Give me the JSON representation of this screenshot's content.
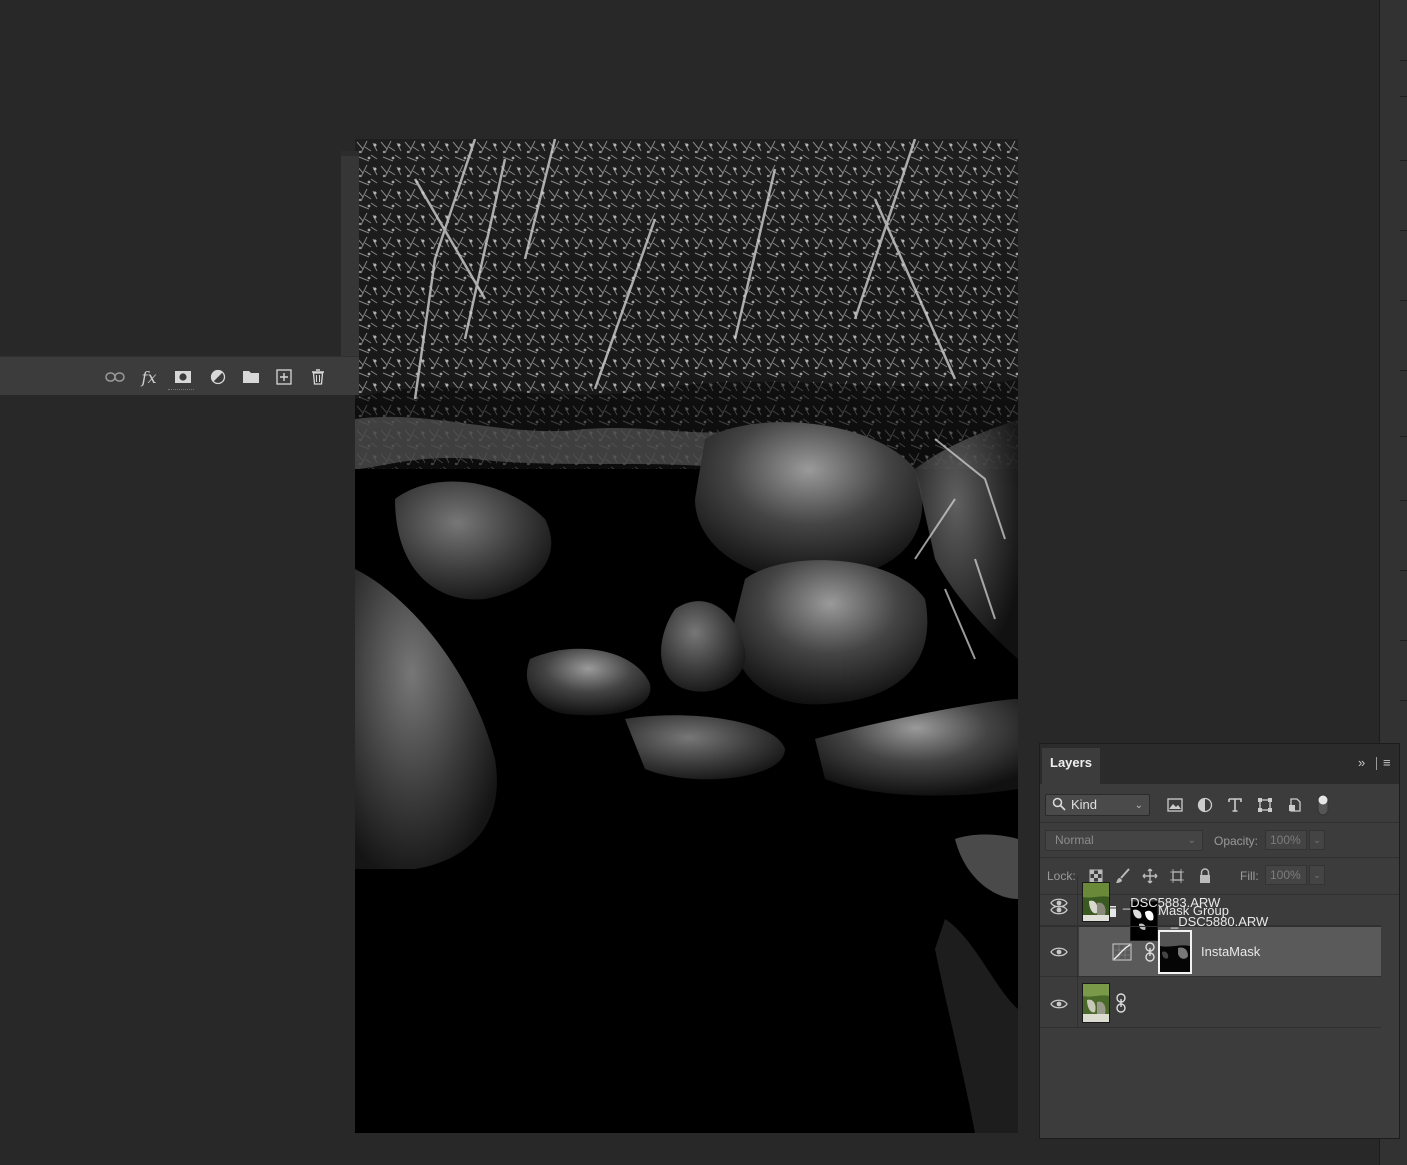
{
  "panel": {
    "tab_label": "Layers",
    "expand_glyph": "»",
    "menu_glyph": "≡",
    "filter": {
      "kind_label": "Kind",
      "icons": [
        "image-filter-icon",
        "adjustment-filter-icon",
        "type-filter-icon",
        "shape-filter-icon",
        "smart-object-filter-icon",
        "filter-toggle-icon"
      ]
    },
    "blend_mode": "Normal",
    "opacity_label": "Opacity:",
    "opacity_value": "100%",
    "lock_label": "Lock:",
    "fill_label": "Fill:",
    "fill_value": "100%"
  },
  "layers": [
    {
      "name": "InstaMask Group",
      "type": "group",
      "expanded": true
    },
    {
      "name": "InstaMask",
      "type": "adjustment",
      "selected": true,
      "clipped": true
    },
    {
      "name": "_DSC5880.ARW",
      "type": "image-with-mask"
    },
    {
      "name": "_DSC5883.ARW",
      "type": "image"
    }
  ],
  "footer_icons": [
    "link-layers-icon",
    "fx-icon",
    "add-mask-icon",
    "new-adjustment-icon",
    "new-group-icon",
    "new-layer-icon",
    "delete-layer-icon"
  ],
  "colors": {
    "workspace": "#282828",
    "panel": "#3c3c3c",
    "selected_row": "#5a5a5a",
    "header": "#2b2b2b"
  }
}
